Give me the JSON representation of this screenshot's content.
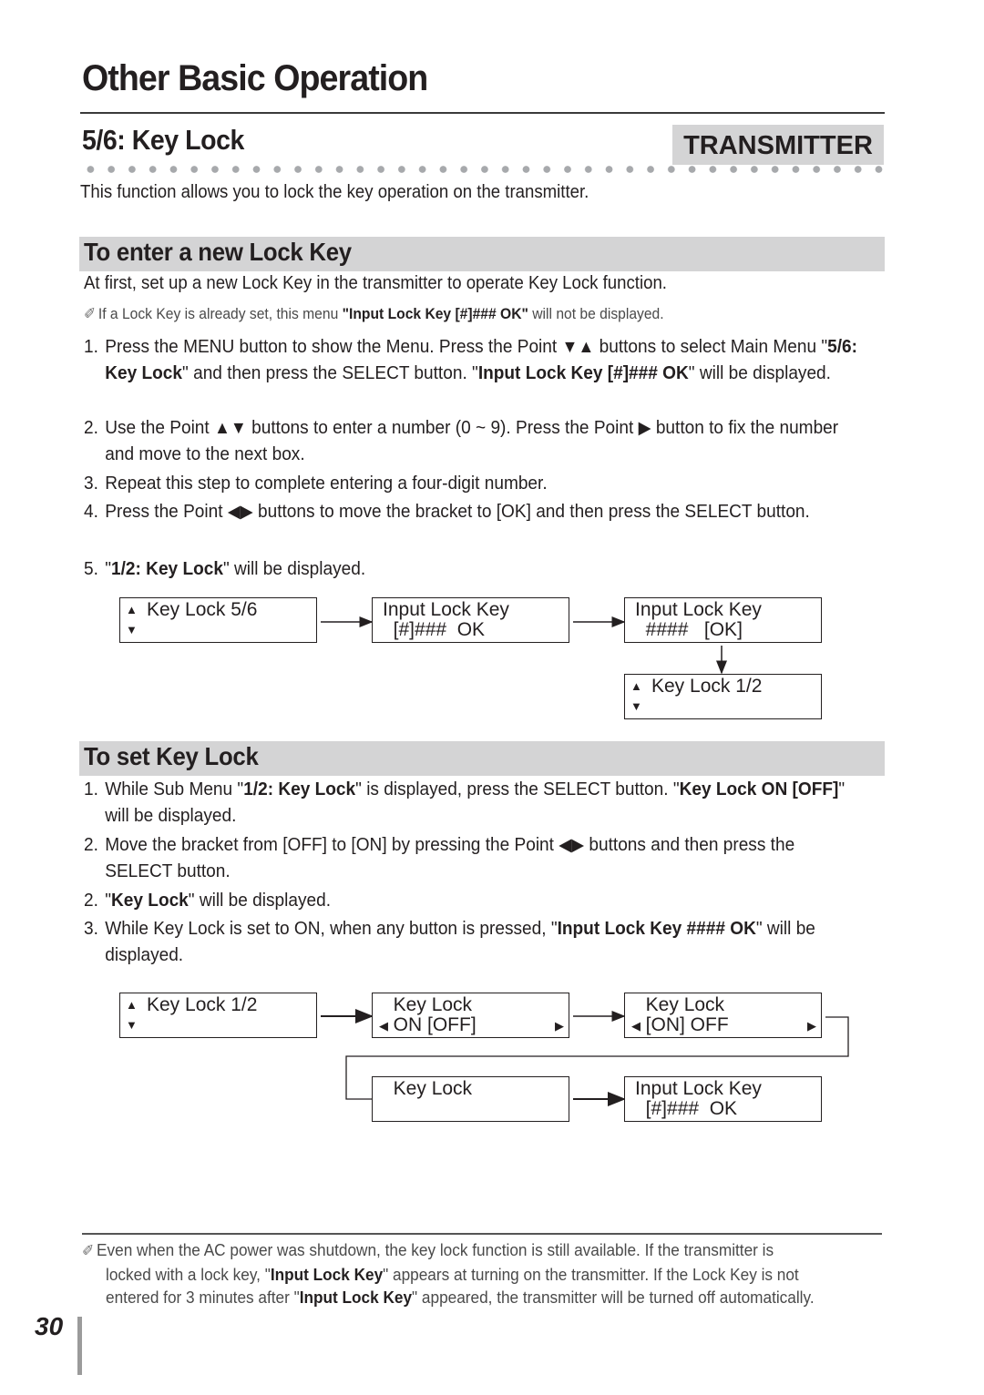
{
  "header": {
    "page_title": "Other Basic Operation",
    "section_title": "5/6: Key Lock",
    "badge": "TRANSMITTER",
    "intro": "This function allows you to lock the key operation on the transmitter."
  },
  "enter_key": {
    "heading": "To enter a new Lock Key",
    "lead": "At first, set up a new Lock Key in the transmitter to operate Key Lock function.",
    "note_icon": "pencil-icon",
    "note": {
      "pre": "If a Lock Key is already set, this menu ",
      "bold": "\"Input Lock Key [#]### OK\"",
      "post": " will not be displayed."
    },
    "steps": [
      {
        "num": "1.",
        "parts": [
          {
            "t": "Press the MENU button to show the Menu. Press the Point "
          },
          {
            "icon": "▼▲",
            "name": "down-up-arrows-icon"
          },
          {
            "t": " buttons to select Main Menu \""
          },
          {
            "b": "5/6: Key Lock"
          },
          {
            "t": "\"  and then press the SELECT button. \""
          },
          {
            "b": "Input Lock Key [#]### OK"
          },
          {
            "t": "\" will be displayed."
          }
        ]
      },
      {
        "num": "2.",
        "parts": [
          {
            "t": "Use the Point "
          },
          {
            "icon": "▲▼",
            "name": "up-down-arrows-icon"
          },
          {
            "t": " buttons to enter a number (0 ~ 9). Press the Point "
          },
          {
            "icon": "▶",
            "name": "right-arrow-icon"
          },
          {
            "t": " button to fix the number and move to the next box."
          }
        ]
      },
      {
        "num": "3.",
        "parts": [
          {
            "t": "Repeat this step to complete entering a four-digit number."
          }
        ]
      },
      {
        "num": "4.",
        "parts": [
          {
            "t": "Press the Point "
          },
          {
            "icon": "◀▶",
            "name": "left-right-arrows-icon"
          },
          {
            "t": " buttons to move the bracket to [OK] and then press the SELECT button."
          }
        ]
      },
      {
        "num": "5.",
        "parts": [
          {
            "t": "\""
          },
          {
            "b": "1/2: Key Lock"
          },
          {
            "t": "\" will be displayed."
          }
        ]
      }
    ],
    "diagram": {
      "screens": [
        {
          "id": "a1",
          "line1": "Key Lock 5/6",
          "line2": "",
          "updown": true
        },
        {
          "id": "a2",
          "line1": "Input Lock Key",
          "line2": "  [#]###  OK",
          "updown": false
        },
        {
          "id": "a3",
          "line1": "Input Lock Key",
          "line2": "  ####   [OK]",
          "updown": false
        },
        {
          "id": "a4",
          "line1": "Key Lock 1/2",
          "line2": "",
          "updown": true
        }
      ]
    }
  },
  "set_lock": {
    "heading": "To set Key Lock",
    "steps": [
      {
        "num": "1.",
        "parts": [
          {
            "t": "While Sub Menu \""
          },
          {
            "b": "1/2: Key Lock"
          },
          {
            "t": "\" is displayed, press the SELECT button. \""
          },
          {
            "b": "Key Lock ON [OFF]"
          },
          {
            "t": "\" will be displayed."
          }
        ]
      },
      {
        "num": "2.",
        "parts": [
          {
            "t": "Move the bracket from [OFF] to [ON] by pressing the Point "
          },
          {
            "icon": "◀▶",
            "name": "left-right-arrows-icon"
          },
          {
            "t": " buttons and then press the SELECT button."
          }
        ]
      },
      {
        "num": "2.",
        "parts": [
          {
            "t": "\""
          },
          {
            "b": "Key Lock"
          },
          {
            "t": "\" will be displayed."
          }
        ]
      },
      {
        "num": "3.",
        "parts": [
          {
            "t": " While Key Lock is set to ON, when any button is pressed, \""
          },
          {
            "b": "Input Lock Key #### OK"
          },
          {
            "t": "\" will be displayed."
          }
        ]
      }
    ],
    "diagram": {
      "screens": [
        {
          "id": "b1",
          "line1": "Key Lock 1/2",
          "line2": "",
          "updown": true,
          "leftright": false
        },
        {
          "id": "b2",
          "line1": "  Key Lock",
          "line2": "  ON [OFF]",
          "updown": false,
          "leftright": true
        },
        {
          "id": "b3",
          "line1": "  Key Lock",
          "line2": "  [ON] OFF",
          "updown": false,
          "leftright": true
        },
        {
          "id": "b4",
          "line1": "  Key Lock",
          "line2": "",
          "updown": false,
          "leftright": false
        },
        {
          "id": "b5",
          "line1": "Input Lock Key",
          "line2": "  [#]###  OK",
          "updown": false,
          "leftright": false
        }
      ]
    }
  },
  "footer": {
    "note_icon": "pencil-icon",
    "note_lines": [
      [
        {
          "t": "Even when the AC power was shutdown, the key lock function is still available. If the transmitter is"
        }
      ],
      [
        {
          "t": "locked with a lock key, \""
        },
        {
          "b": "Input Lock Key"
        },
        {
          "t": "\" appears at turning on the transmitter. If the Lock Key is not"
        }
      ],
      [
        {
          "t": "entered for 3 minutes after \""
        },
        {
          "b": "Input Lock Key"
        },
        {
          "t": "\" appeared, the transmitter will be turned off automatically."
        }
      ]
    ],
    "page_number": "30"
  }
}
